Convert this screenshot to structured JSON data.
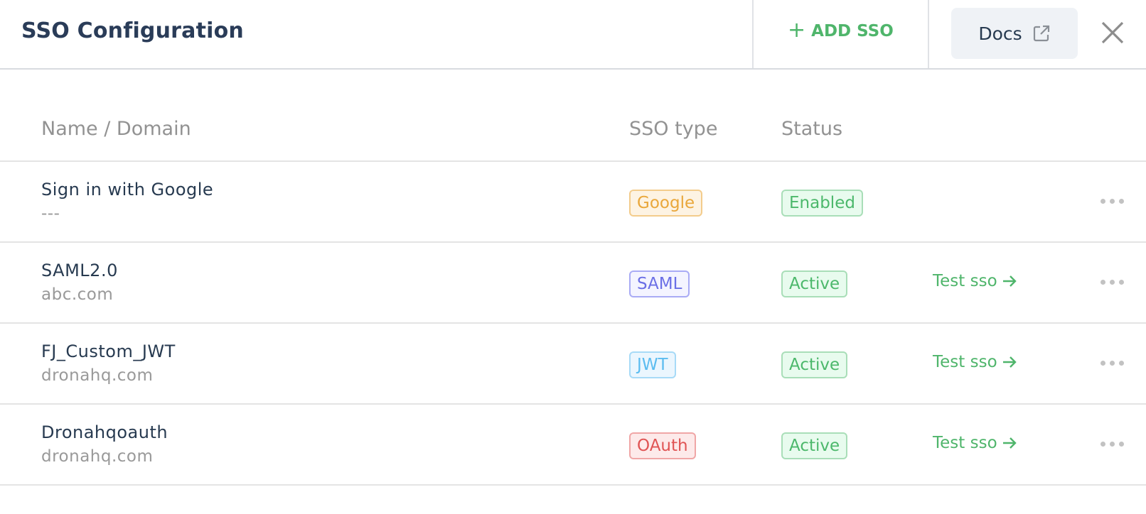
{
  "header": {
    "title": "SSO Configuration",
    "add_sso_label": "ADD SSO",
    "docs_label": "Docs"
  },
  "table": {
    "columns": [
      "Name / Domain",
      "SSO type",
      "Status"
    ],
    "rows": [
      {
        "name": "Sign in with Google",
        "domain": "---",
        "type": "Google",
        "type_color": "#e9a73b",
        "type_bg": "#fdf3e3",
        "type_border": "#f3cc8c",
        "status": "Enabled",
        "test_label": ""
      },
      {
        "name": "SAML2.0",
        "domain": "abc.com",
        "type": "SAML",
        "type_color": "#6b6fe6",
        "type_bg": "#f4f4ff",
        "type_border": "#a9abf5",
        "status": "Active",
        "test_label": "Test sso"
      },
      {
        "name": "FJ_Custom_JWT",
        "domain": "dronahq.com",
        "type": "JWT",
        "type_color": "#5bbcf0",
        "type_bg": "#ebf6fe",
        "type_border": "#a7daf7",
        "status": "Active",
        "test_label": "Test sso"
      },
      {
        "name": "Dronahqoauth",
        "domain": "dronahq.com",
        "type": "OAuth",
        "type_color": "#e05454",
        "type_bg": "#fdeaea",
        "type_border": "#f0a6a6",
        "status": "Active",
        "test_label": "Test sso"
      }
    ]
  },
  "colors": {
    "accent_green": "#4fb56b",
    "title": "#2a3c58",
    "muted": "#929292"
  }
}
